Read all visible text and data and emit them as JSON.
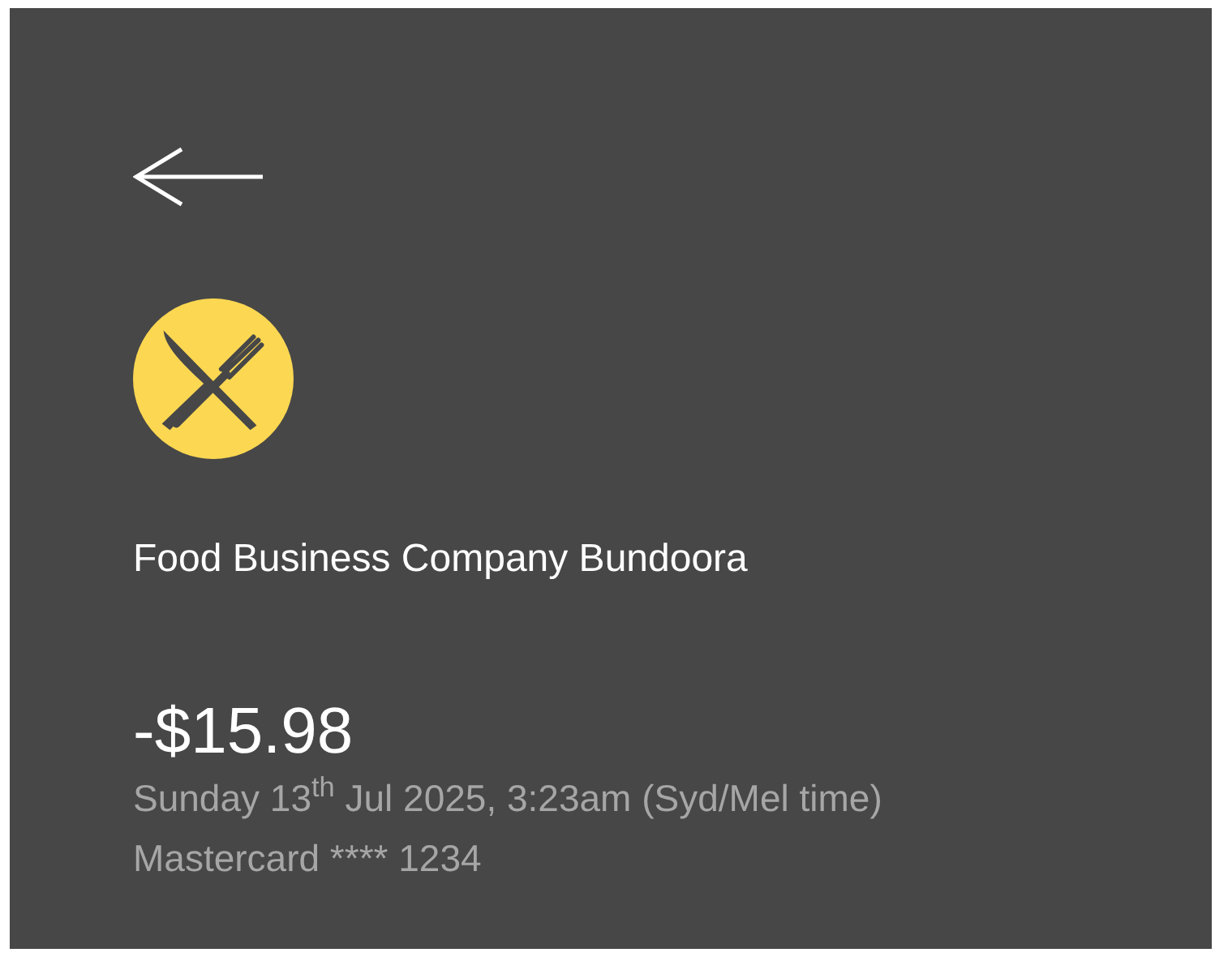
{
  "merchant": "Food Business Company Bundoora",
  "amount": "-$15.98",
  "date": "Sunday 13$^{th}$ Jul 2025, 3:23am (Syd/Mel time)",
  "card": "Mastercard **** 1234"
}
